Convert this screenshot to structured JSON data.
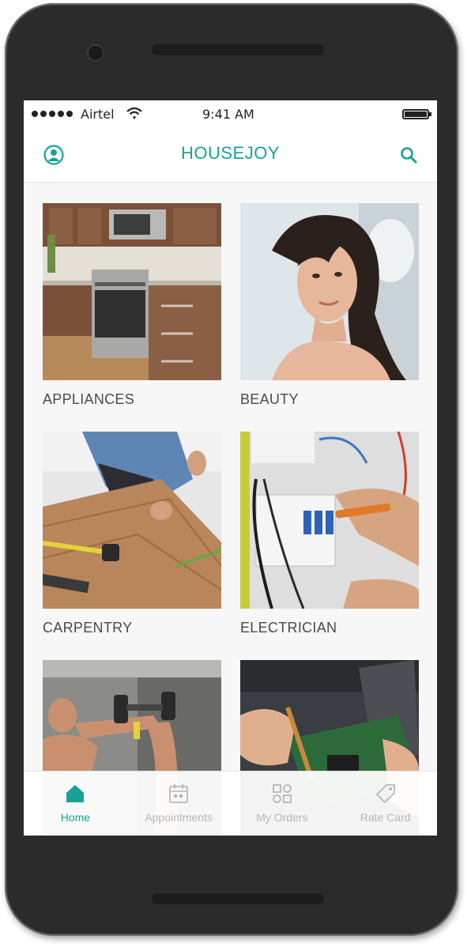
{
  "colors": {
    "accent": "#17a398",
    "inactive": "#b7b7b7",
    "text": "#4a4a4a"
  },
  "status_bar": {
    "carrier": "Airtel",
    "time": "9:41 AM"
  },
  "app_bar": {
    "title": "HOUSEJOY",
    "left_icon": "profile-icon",
    "right_icon": "search-icon"
  },
  "categories": [
    {
      "label": "APPLIANCES",
      "image": "kitchen-appliances-photo"
    },
    {
      "label": "BEAUTY",
      "image": "woman-portrait-photo"
    },
    {
      "label": "CARPENTRY",
      "image": "carpenter-measuring-wood-photo"
    },
    {
      "label": "ELECTRICIAN",
      "image": "electrician-wiring-panel-photo"
    },
    {
      "label": "",
      "image": "man-lifting-dumbbell-photo"
    },
    {
      "label": "",
      "image": "laptop-repair-photo"
    }
  ],
  "tabs": [
    {
      "label": "Home",
      "icon": "home-icon",
      "active": true
    },
    {
      "label": "Appointments",
      "icon": "calendar-icon",
      "active": false
    },
    {
      "label": "My Orders",
      "icon": "orders-icon",
      "active": false
    },
    {
      "label": "Rate Card",
      "icon": "tag-icon",
      "active": false
    }
  ]
}
